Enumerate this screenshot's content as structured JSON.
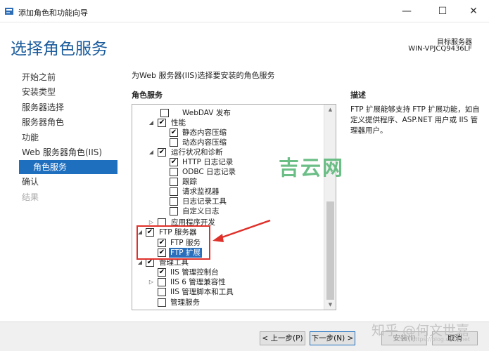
{
  "window": {
    "title": "添加角色和功能向导",
    "minimize_glyph": "—",
    "maximize_glyph": "☐",
    "close_glyph": "✕"
  },
  "header": {
    "title": "选择角色服务",
    "target_label": "目标服务器",
    "target_value": "WIN-VPJCQ9436LF"
  },
  "nav": {
    "items": [
      {
        "label": "开始之前",
        "state": "normal"
      },
      {
        "label": "安装类型",
        "state": "normal"
      },
      {
        "label": "服务器选择",
        "state": "normal"
      },
      {
        "label": "服务器角色",
        "state": "normal"
      },
      {
        "label": "功能",
        "state": "normal"
      },
      {
        "label": "Web 服务器角色(IIS)",
        "state": "normal"
      },
      {
        "label": "角色服务",
        "state": "active"
      },
      {
        "label": "确认",
        "state": "normal"
      },
      {
        "label": "结果",
        "state": "disabled"
      }
    ]
  },
  "main": {
    "instruction": "为Web 服务器(IIS)选择要安装的角色服务",
    "roles_heading": "角色服务",
    "description_heading": "描述",
    "description_text": "FTP 扩展能够支持 FTP 扩展功能，如自定义提供程序、ASP.NET 用户或 IIS 管理器用户。"
  },
  "tree": {
    "items": [
      {
        "label": "WebDAV 发布",
        "checked": false,
        "expander": "",
        "selected": false
      },
      {
        "label": "性能",
        "checked": true,
        "expander": "◢",
        "selected": false
      },
      {
        "label": "静态内容压缩",
        "checked": true,
        "expander": "",
        "selected": false
      },
      {
        "label": "动态内容压缩",
        "checked": false,
        "expander": "",
        "selected": false
      },
      {
        "label": "运行状况和诊断",
        "checked": true,
        "expander": "◢",
        "selected": false
      },
      {
        "label": "HTTP 日志记录",
        "checked": true,
        "expander": "",
        "selected": false
      },
      {
        "label": "ODBC 日志记录",
        "checked": false,
        "expander": "",
        "selected": false
      },
      {
        "label": "跟踪",
        "checked": false,
        "expander": "",
        "selected": false
      },
      {
        "label": "请求监视器",
        "checked": false,
        "expander": "",
        "selected": false
      },
      {
        "label": "日志记录工具",
        "checked": false,
        "expander": "",
        "selected": false
      },
      {
        "label": "自定义日志",
        "checked": false,
        "expander": "",
        "selected": false
      },
      {
        "label": "应用程序开发",
        "checked": false,
        "expander": "▷",
        "selected": false
      },
      {
        "label": "FTP 服务器",
        "checked": true,
        "expander": "◢",
        "selected": false
      },
      {
        "label": "FTP 服务",
        "checked": true,
        "expander": "",
        "selected": false
      },
      {
        "label": "FTP 扩展",
        "checked": true,
        "expander": "",
        "selected": true
      },
      {
        "label": "管理工具",
        "checked": true,
        "expander": "◢",
        "selected": false
      },
      {
        "label": "IIS 管理控制台",
        "checked": true,
        "expander": "",
        "selected": false
      },
      {
        "label": "IIS 6 管理兼容性",
        "checked": false,
        "expander": "▷",
        "selected": false
      },
      {
        "label": "IIS 管理脚本和工具",
        "checked": false,
        "expander": "",
        "selected": false
      },
      {
        "label": "管理服务",
        "checked": false,
        "expander": "",
        "selected": false
      }
    ],
    "check_glyph": "✔",
    "scroll_up_glyph": "▲",
    "scroll_down_glyph": "▼"
  },
  "footer": {
    "prev_label": "< 上一步(P)",
    "next_label": "下一步(N) >",
    "install_label": "安装(I)",
    "cancel_label": "取消"
  },
  "watermarks": {
    "site": "吉云网",
    "zhihu": "知乎 @何文世嘉",
    "credit": "https://blog.csdn.net"
  },
  "colors": {
    "accent": "#1f6fbf",
    "title_blue": "#1c5c9c",
    "annotation_red": "#e0302a",
    "watermark_green": "#5db87b"
  }
}
